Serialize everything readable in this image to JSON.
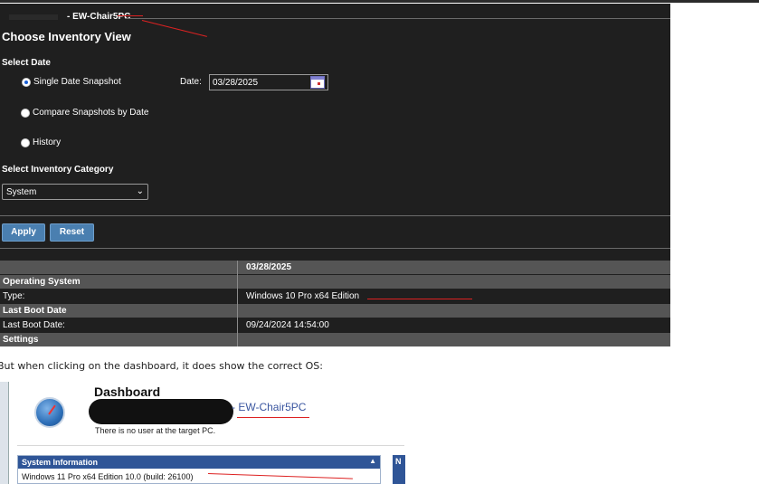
{
  "panel": {
    "pc_name": "- EW-Chair5PC",
    "title": "Choose Inventory View",
    "select_date_label": "Select Date",
    "options": [
      {
        "label": "Single Date Snapshot",
        "checked": true
      },
      {
        "label": "Compare Snapshots by Date",
        "checked": false
      },
      {
        "label": "History",
        "checked": false
      }
    ],
    "date_label": "Date:",
    "date_value": "03/28/2025",
    "category_label": "Select Inventory Category",
    "category_value": "System",
    "apply_label": "Apply",
    "reset_label": "Reset"
  },
  "table": {
    "header_date": "03/28/2025",
    "rows": [
      {
        "kind": "group",
        "c1": "Operating System",
        "c2": ""
      },
      {
        "kind": "data",
        "c1": "Type:",
        "c2": "Windows 10 Pro x64 Edition"
      },
      {
        "kind": "group",
        "c1": "Last Boot Date",
        "c2": ""
      },
      {
        "kind": "data",
        "c1": "Last Boot Date:",
        "c2": "09/24/2024 14:54:00"
      },
      {
        "kind": "group",
        "c1": "Settings",
        "c2": ""
      }
    ]
  },
  "note": "But when clicking on the dashboard, it does show the correct OS:",
  "dashboard": {
    "title": "Dashboard",
    "pc_name": "- EW-Chair5PC",
    "subtitle": "There is no user at the target PC.",
    "sysinfo_header": "System Information",
    "sysinfo_arrow": "▲",
    "sysinfo_value": "Windows 11 Pro x64 Edition 10.0 (build: 26100)",
    "side_header": "N"
  },
  "colors": {
    "panel_bg": "#1f1f1f",
    "group_bg": "#555555",
    "button_bg": "#4a7fb0",
    "annotation_red": "#dd2222",
    "sysinfo_header_bg": "#2f5597"
  }
}
